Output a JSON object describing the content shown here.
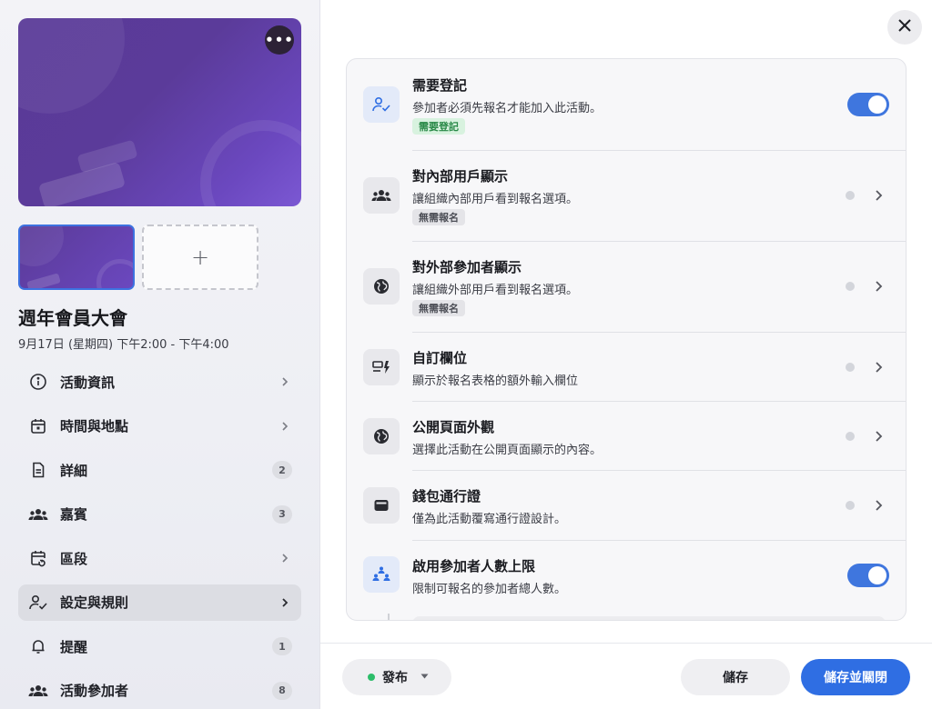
{
  "left": {
    "more_label": "•••",
    "add_label": "+",
    "event_title": "週年會員大會",
    "event_time": "9月17日 (星期四) 下午2:00 - 下午4:00",
    "nav": [
      {
        "label": "活動資訊",
        "icon": "info-icon",
        "count": null,
        "active": false
      },
      {
        "label": "時間與地點",
        "icon": "calendar-icon",
        "count": null,
        "active": false
      },
      {
        "label": "詳細",
        "icon": "document-icon",
        "count": "2",
        "active": false
      },
      {
        "label": "嘉賓",
        "icon": "people-icon",
        "count": "3",
        "active": false
      },
      {
        "label": "區段",
        "icon": "calendar-repeat-icon",
        "count": null,
        "active": false
      },
      {
        "label": "設定與規則",
        "icon": "user-check-icon",
        "count": null,
        "active": true
      },
      {
        "label": "提醒",
        "icon": "bell-icon",
        "count": "1",
        "active": false
      },
      {
        "label": "活動參加者",
        "icon": "group-icon",
        "count": "8",
        "active": false
      }
    ]
  },
  "settings": {
    "rows": [
      {
        "title": "需要登記",
        "desc": "參加者必須先報名才能加入此活動。",
        "tag": "需要登記",
        "icon": "user-check-icon",
        "control": "toggle-on"
      },
      {
        "title": "對內部用戶顯示",
        "desc": "讓組織內部用戶看到報名選項。",
        "tag": "無需報名",
        "icon": "people-icon",
        "control": "chevron"
      },
      {
        "title": "對外部參加者顯示",
        "desc": "讓組織外部用戶看到報名選項。",
        "tag": "無需報名",
        "icon": "globe-icon",
        "control": "chevron"
      },
      {
        "title": "自訂欄位",
        "desc": "顯示於報名表格的額外輸入欄位",
        "tag": null,
        "icon": "form-field-icon",
        "control": "chevron"
      },
      {
        "title": "公開頁面外觀",
        "desc": "選擇此活動在公開頁面顯示的內容。",
        "tag": null,
        "icon": "globe-icon",
        "control": "chevron"
      },
      {
        "title": "錢包通行證",
        "desc": "僅為此活動覆寫通行證設計。",
        "tag": null,
        "icon": "wallet-icon",
        "control": "chevron"
      },
      {
        "title": "啟用參加者人數上限",
        "desc": "限制可報名的參加者總人數。",
        "tag": null,
        "icon": "group-limit-icon",
        "control": "toggle-on"
      }
    ]
  },
  "footer": {
    "publish_label": "發布",
    "publish_status_color": "#2cbd6a",
    "save_label": "儲存",
    "save_close_label": "儲存並關閉"
  },
  "colors": {
    "accent": "#2f6ee3",
    "toggle_on": "#3f76de",
    "tag_green_bg": "#d8f2df",
    "tag_green_text": "#2a8a48"
  }
}
